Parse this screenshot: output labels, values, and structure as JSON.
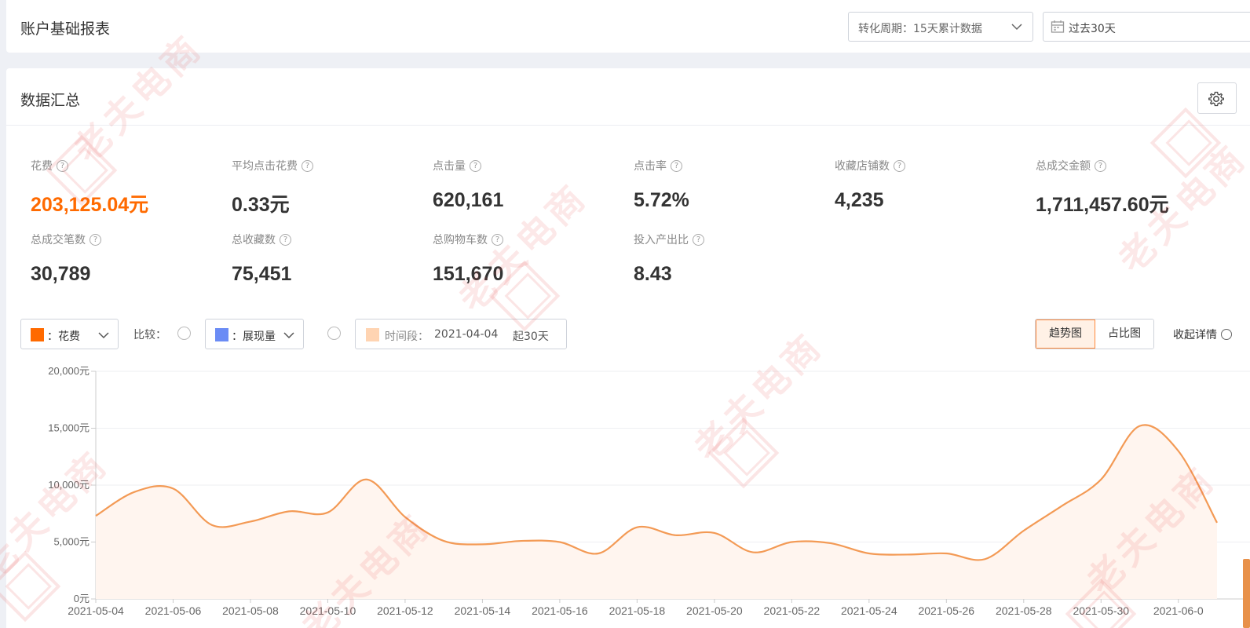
{
  "header": {
    "title": "账户基础报表",
    "cycle_select": "转化周期：15天累计数据",
    "date_select": "过去30天"
  },
  "summary": {
    "title": "数据汇总",
    "metrics": [
      {
        "label": "花费",
        "value": "203,125.04元",
        "accent": true
      },
      {
        "label": "平均点击花费",
        "value": "0.33元"
      },
      {
        "label": "点击量",
        "value": "620,161"
      },
      {
        "label": "点击率",
        "value": "5.72%"
      },
      {
        "label": "收藏店铺数",
        "value": "4,235"
      },
      {
        "label": "总成交金额",
        "value": "1,711,457.60元"
      },
      {
        "label": "总成交笔数",
        "value": "30,789"
      },
      {
        "label": "总收藏数",
        "value": "75,451"
      },
      {
        "label": "总购物车数",
        "value": "151,670"
      },
      {
        "label": "投入产出比",
        "value": "8.43"
      }
    ]
  },
  "controls": {
    "metric1": "：花费",
    "metric1_color": "#ff6a00",
    "compare_label": "比较：",
    "metric2": "：展现量",
    "metric2_color": "#6b8cf5",
    "period_label": "时间段：",
    "period_date": "2021-04-04",
    "period_duration": "起30天",
    "period_color": "#ffd4b2",
    "view_trend": "趋势图",
    "view_ratio": "占比图",
    "collapse": "收起详情"
  },
  "watermark": "老夫电商",
  "chart_data": {
    "type": "area",
    "color": "#f39a55",
    "fill": "#fff5ef",
    "yticks": [
      "20,000元",
      "15,000元",
      "10,000元",
      "5,000元",
      "0元"
    ],
    "ylim": [
      0,
      20000
    ],
    "xticks": [
      "2021-05-04",
      "2021-05-06",
      "2021-05-08",
      "2021-05-10",
      "2021-05-12",
      "2021-05-14",
      "2021-05-16",
      "2021-05-18",
      "2021-05-20",
      "2021-05-22",
      "2021-05-24",
      "2021-05-26",
      "2021-05-28",
      "2021-05-30",
      "2021-06-0"
    ],
    "x": [
      "2021-05-04",
      "2021-05-05",
      "2021-05-06",
      "2021-05-07",
      "2021-05-08",
      "2021-05-09",
      "2021-05-10",
      "2021-05-11",
      "2021-05-12",
      "2021-05-13",
      "2021-05-14",
      "2021-05-15",
      "2021-05-16",
      "2021-05-17",
      "2021-05-18",
      "2021-05-19",
      "2021-05-20",
      "2021-05-21",
      "2021-05-22",
      "2021-05-23",
      "2021-05-24",
      "2021-05-25",
      "2021-05-26",
      "2021-05-27",
      "2021-05-28",
      "2021-05-29",
      "2021-05-30",
      "2021-05-31",
      "2021-06-01",
      "2021-06-02"
    ],
    "values": [
      7300,
      9400,
      9700,
      6500,
      6800,
      7700,
      7600,
      10500,
      7200,
      5100,
      4800,
      5100,
      5000,
      4000,
      6300,
      5600,
      5800,
      4100,
      5000,
      4900,
      4000,
      3900,
      4000,
      3500,
      6000,
      8200,
      10500,
      15200,
      13000,
      6700
    ],
    "grid": true
  }
}
